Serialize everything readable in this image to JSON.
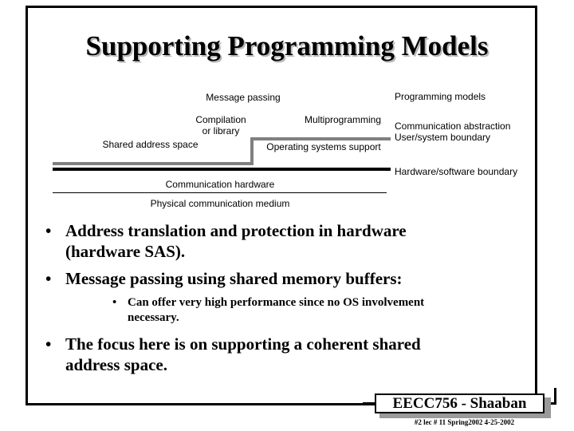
{
  "slide": {
    "title": "Supporting Programming Models"
  },
  "diagram": {
    "labels": {
      "message_passing": "Message passing",
      "programming_models": "Programming models",
      "compilation_line1": "Compilation",
      "compilation_line2": "or library",
      "multiprogramming": "Multiprogramming",
      "communication_abstraction": "Communication abstraction",
      "user_system_boundary": "User/system boundary",
      "shared_address_space": "Shared address space",
      "operating_systems_support": "Operating systems support",
      "hardware_software_boundary": "Hardware/software boundary",
      "communication_hardware": "Communication hardware",
      "physical_communication_medium": "Physical communication medium"
    },
    "colors": {
      "user_system_line": "#808080",
      "hardware_software_line": "#000000",
      "medium_line": "#000000"
    }
  },
  "bullets": [
    {
      "level": 1,
      "marker": "•",
      "lines": [
        "Address translation and protection in hardware",
        "(hardware SAS)."
      ]
    },
    {
      "level": 1,
      "marker": "•",
      "lines": [
        "Message passing using shared memory buffers:"
      ]
    },
    {
      "level": 2,
      "marker": "•",
      "lines": [
        "Can offer very high performance since no OS involvement",
        "necessary."
      ]
    },
    {
      "level": 1,
      "marker": "•",
      "lines": [
        "The focus here is on supporting a coherent shared",
        "address space."
      ]
    }
  ],
  "footer": {
    "course": "EECC756 - Shaaban",
    "details": "#2  lec # 11   Spring2002  4-25-2002"
  }
}
